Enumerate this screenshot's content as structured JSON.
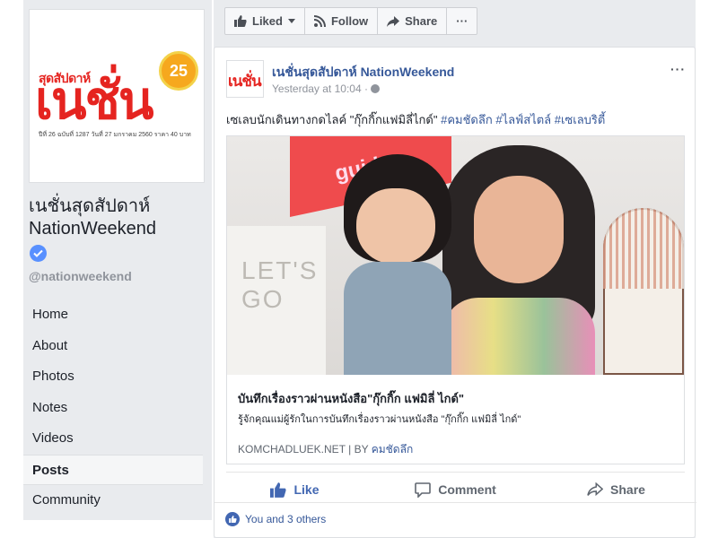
{
  "sidebar": {
    "logo": {
      "brand_small": "สุดสัปดาห์",
      "brand_big": "เนชั่น",
      "badge": "25",
      "fine_print": "ปีที่ 26 ฉบับที่ 1287 วันที่ 27 มกราคม 2560 ราคา 40 บาท"
    },
    "page_name": "เนชั่นสุดสัปดาห์ NationWeekend",
    "handle": "@nationweekend",
    "nav": [
      "Home",
      "About",
      "Photos",
      "Notes",
      "Videos",
      "Posts",
      "Community"
    ],
    "active_nav": "Posts"
  },
  "action_bar": {
    "liked": "Liked",
    "follow": "Follow",
    "share": "Share",
    "more": "···"
  },
  "post": {
    "author": "เนชั่นสุดสัปดาห์ NationWeekend",
    "avatar_text": "เนชั่น",
    "time": "Yesterday at 10:04 ·",
    "more": "···",
    "text": "เซเลบนักเดินทางกดไลค์ \"กุ๊กกิ๊กแฟมิลี่ไกด์\" ",
    "hashtags": "#คมชัดลึก #ไลฟ์สไตล์ #เซเลบริตี้",
    "link": {
      "image_sign_text": "guide",
      "image_wall_text": "LET'S GO",
      "title": "บันทึกเรื่องราวผ่านหนังสือ\"กุ๊กกิ๊ก แฟมิลี่ ไกด์\"",
      "description": "รู้จักคุณแม่ผู้รักในการบันทึกเรื่องราวผ่านหนังสือ \"กุ๊กกิ๊ก แฟมิลี่ ไกด์\"",
      "source": "KOMCHADLUEK.NET | BY ",
      "by": "คมชัดลึก"
    },
    "actions": {
      "like": "Like",
      "comment": "Comment",
      "share": "Share"
    },
    "likes_text": "You and 3 others"
  },
  "colors": {
    "brand_red": "#e52420",
    "facebook_blue": "#4267b2",
    "link_blue": "#365899",
    "background": "#e9ebee"
  }
}
